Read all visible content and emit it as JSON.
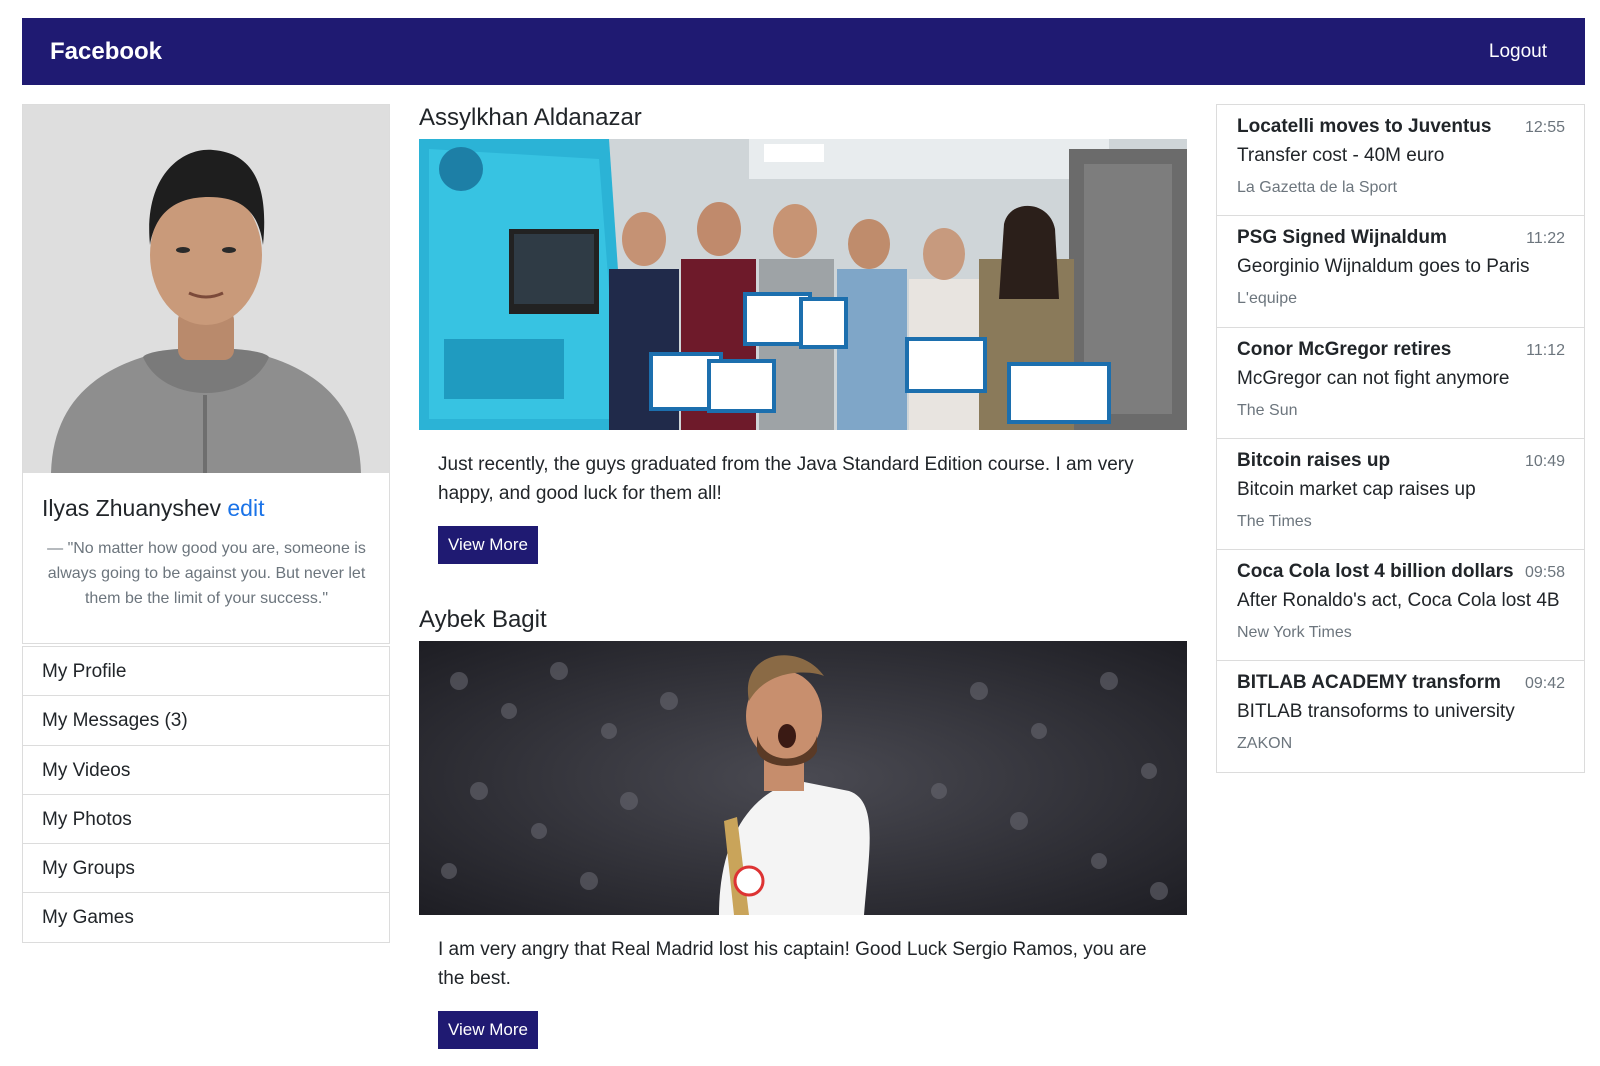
{
  "navbar": {
    "brand": "Facebook",
    "logout": "Logout",
    "background": "#1f1a72"
  },
  "profile": {
    "name": "Ilyas Zhuanyshev",
    "edit": "edit",
    "quote": "— \"No matter how good you are, someone is always going to be against you. But never let them be the limit of your success.\""
  },
  "menu": {
    "items": [
      {
        "label": "My Profile"
      },
      {
        "label": "My Messages (3)"
      },
      {
        "label": "My Videos"
      },
      {
        "label": "My Photos"
      },
      {
        "label": "My Groups"
      },
      {
        "label": "My Games"
      }
    ]
  },
  "posts": [
    {
      "author": "Assylkhan Aldanazar",
      "text": "Just recently, the guys graduated from the Java Standard Edition course. I am very happy, and good luck for them all!",
      "button": "View More"
    },
    {
      "author": "Aybek Bagit",
      "text": "I am very angry that Real Madrid lost his captain! Good Luck Sergio Ramos, you are the best.",
      "button": "View More"
    }
  ],
  "news": [
    {
      "title": "Locatelli moves to Juventus",
      "time": "12:55",
      "desc": "Transfer cost - 40M euro",
      "source": "La Gazetta de la Sport"
    },
    {
      "title": "PSG Signed Wijnaldum",
      "time": "11:22",
      "desc": "Georginio Wijnaldum goes to Paris",
      "source": "L'equipe"
    },
    {
      "title": "Conor McGregor retires",
      "time": "11:12",
      "desc": "McGregor can not fight anymore",
      "source": "The Sun"
    },
    {
      "title": "Bitcoin raises up",
      "time": "10:49",
      "desc": "Bitcoin market cap raises up",
      "source": "The Times"
    },
    {
      "title": "Coca Cola lost 4 billion dollars",
      "time": "09:58",
      "desc": "After Ronaldo's act, Coca Cola lost 4B",
      "source": "New York Times"
    },
    {
      "title": "BITLAB ACADEMY transform",
      "time": "09:42",
      "desc": "BITLAB transoforms to university",
      "source": "ZAKON"
    }
  ]
}
